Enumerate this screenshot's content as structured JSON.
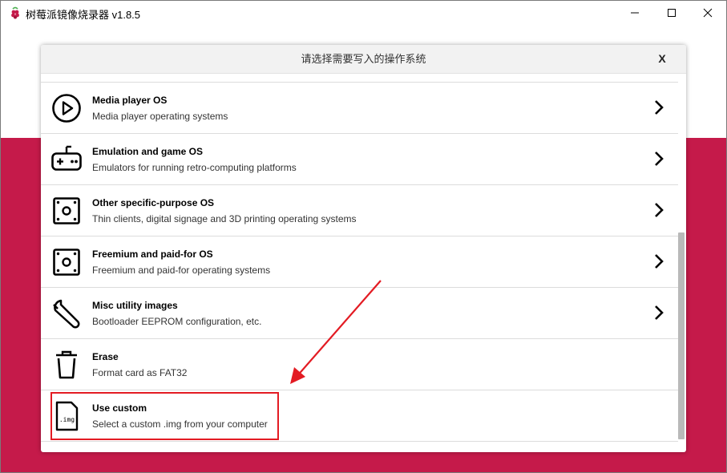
{
  "window": {
    "title": "树莓派镜像烧录器 v1.8.5",
    "icon": "raspberry-icon",
    "controls": [
      "minimize-icon",
      "maximize-icon",
      "close-icon"
    ],
    "accent_color": "#c51a4a"
  },
  "dialog": {
    "title": "请选择需要写入的操作系统",
    "close_label": "X",
    "items": [
      {
        "name": "Media player OS",
        "description": "Media player operating systems",
        "icon": "play-circle-icon",
        "has_submenu": true
      },
      {
        "name": "Emulation and game OS",
        "description": "Emulators for running retro-computing platforms",
        "icon": "gamepad-icon",
        "has_submenu": true
      },
      {
        "name": "Other specific-purpose OS",
        "description": "Thin clients, digital signage and 3D printing operating systems",
        "icon": "chip-box-icon",
        "has_submenu": true
      },
      {
        "name": "Freemium and paid-for OS",
        "description": "Freemium and paid-for operating systems",
        "icon": "chip-box-icon",
        "has_submenu": true
      },
      {
        "name": "Misc utility images",
        "description": "Bootloader EEPROM configuration, etc.",
        "icon": "wrench-icon",
        "has_submenu": true
      },
      {
        "name": "Erase",
        "description": "Format card as FAT32",
        "icon": "trash-icon",
        "has_submenu": false
      },
      {
        "name": "Use custom",
        "description": "Select a custom .img from your computer",
        "icon": "img-file-icon",
        "icon_text": ".img",
        "has_submenu": false
      }
    ]
  },
  "annotation": {
    "highlight_color": "#e31b23",
    "target": "Use custom"
  }
}
